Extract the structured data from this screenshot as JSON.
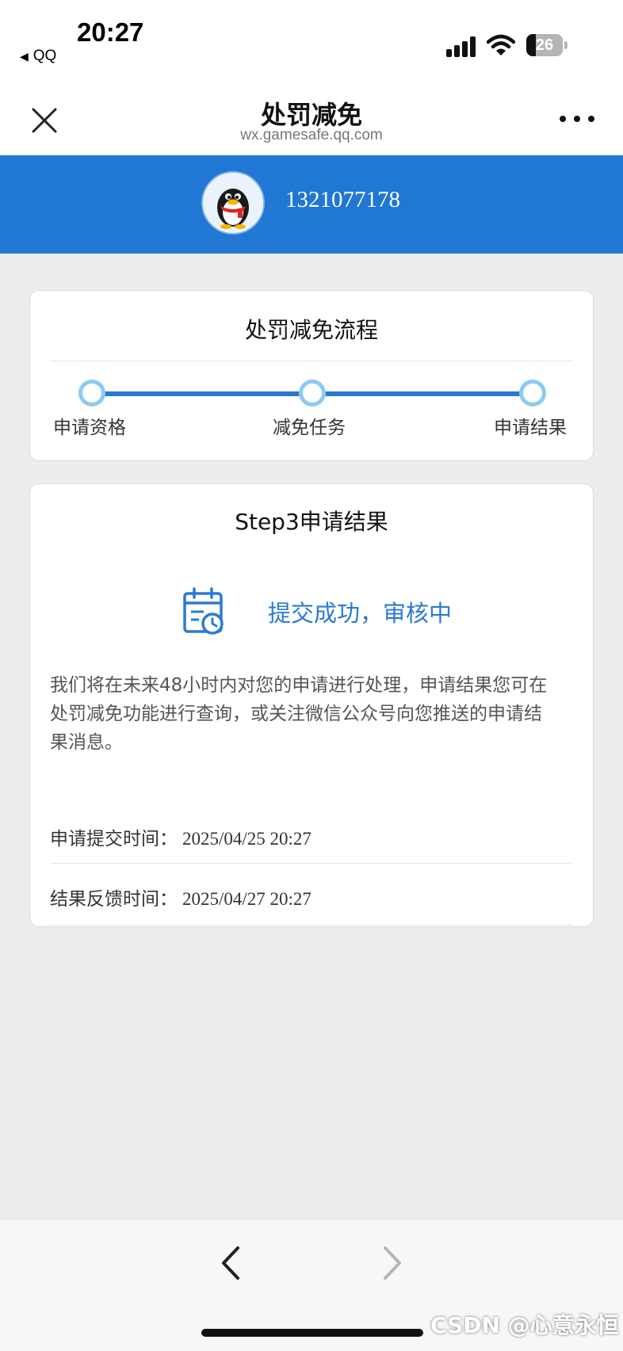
{
  "status_bar": {
    "time": "20:27",
    "back_app": "QQ",
    "battery": "26",
    "battery_level": 0.26
  },
  "nav": {
    "title": "处罚减免",
    "url": "wx.gamesafe.qq.com"
  },
  "profile": {
    "account": "1321077178"
  },
  "process": {
    "title": "处罚减免流程",
    "steps": [
      "申请资格",
      "减免任务",
      "申请结果"
    ]
  },
  "result": {
    "title": "Step3申请结果",
    "status": "提交成功，审核中",
    "description": "我们将在未来48小时内对您的申请进行处理，申请结果您可在处罚减免功能进行查询，或关注微信公众号向您推送的申请结果消息。",
    "submit_label": "申请提交时间：",
    "submit_time": "2025/04/25 20:27",
    "feedback_label": "结果反馈时间：",
    "feedback_time": "2025/04/27 20:27"
  },
  "watermark": "CSDN @心意永恒",
  "colors": {
    "accent": "#2077d4",
    "step_dot": "#8ccaf2",
    "status_text": "#2a7bd2"
  },
  "icons": [
    "close-icon",
    "more-icon",
    "calendar-clock-icon",
    "back-arrow-icon",
    "forward-arrow-icon"
  ]
}
